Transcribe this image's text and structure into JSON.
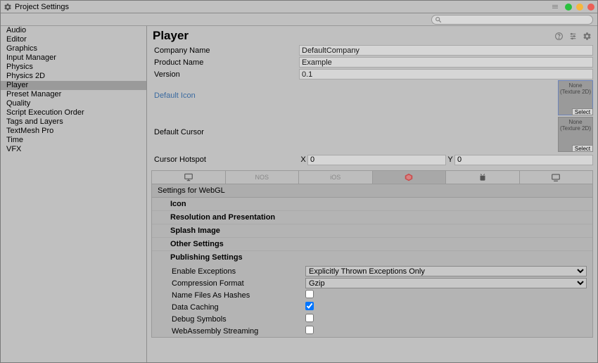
{
  "window_title": "Project Settings",
  "search_placeholder": "",
  "sidebar": {
    "items": [
      {
        "label": "Audio",
        "selected": false
      },
      {
        "label": "Editor",
        "selected": false
      },
      {
        "label": "Graphics",
        "selected": false
      },
      {
        "label": "Input Manager",
        "selected": false
      },
      {
        "label": "Physics",
        "selected": false
      },
      {
        "label": "Physics 2D",
        "selected": false
      },
      {
        "label": "Player",
        "selected": true
      },
      {
        "label": "Preset Manager",
        "selected": false
      },
      {
        "label": "Quality",
        "selected": false
      },
      {
        "label": "Script Execution Order",
        "selected": false
      },
      {
        "label": "Tags and Layers",
        "selected": false
      },
      {
        "label": "TextMesh Pro",
        "selected": false
      },
      {
        "label": "Time",
        "selected": false
      },
      {
        "label": "VFX",
        "selected": false
      }
    ]
  },
  "panel": {
    "title": "Player",
    "company_name_label": "Company Name",
    "company_name_value": "DefaultCompany",
    "product_name_label": "Product Name",
    "product_name_value": "Example",
    "version_label": "Version",
    "version_value": "0.1",
    "default_icon_label": "Default Icon",
    "default_cursor_label": "Default Cursor",
    "asset_none_text": "None (Texture 2D)",
    "asset_select_label": "Select",
    "cursor_hotspot_label": "Cursor Hotspot",
    "cursor_hotspot_x_label": "X",
    "cursor_hotspot_x_value": "0",
    "cursor_hotspot_y_label": "Y",
    "cursor_hotspot_y_value": "0"
  },
  "platforms": {
    "tabs": [
      "desktop",
      "nos",
      "ios",
      "webgl",
      "android",
      "tv"
    ],
    "selected_index": 3,
    "settings_for_label": "Settings for WebGL",
    "foldouts": [
      "Icon",
      "Resolution and Presentation",
      "Splash Image",
      "Other Settings",
      "Publishing Settings"
    ]
  },
  "publishing": {
    "enable_exceptions_label": "Enable Exceptions",
    "enable_exceptions_value": "Explicitly Thrown Exceptions Only",
    "compression_format_label": "Compression Format",
    "compression_format_value": "Gzip",
    "name_files_as_hashes_label": "Name Files As Hashes",
    "name_files_as_hashes_checked": false,
    "data_caching_label": "Data Caching",
    "data_caching_checked": true,
    "debug_symbols_label": "Debug Symbols",
    "debug_symbols_checked": false,
    "webassembly_streaming_label": "WebAssembly Streaming",
    "webassembly_streaming_checked": false
  }
}
